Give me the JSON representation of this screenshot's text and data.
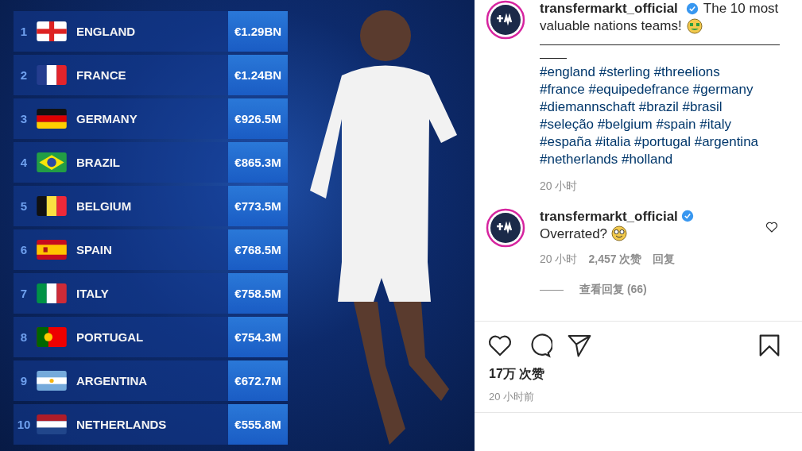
{
  "post_image": {
    "rows": [
      {
        "rank": "1",
        "country": "ENGLAND",
        "value": "€1.29BN"
      },
      {
        "rank": "2",
        "country": "FRANCE",
        "value": "€1.24BN"
      },
      {
        "rank": "3",
        "country": "GERMANY",
        "value": "€926.5M"
      },
      {
        "rank": "4",
        "country": "BRAZIL",
        "value": "€865.3M"
      },
      {
        "rank": "5",
        "country": "BELGIUM",
        "value": "€773.5M"
      },
      {
        "rank": "6",
        "country": "SPAIN",
        "value": "€768.5M"
      },
      {
        "rank": "7",
        "country": "ITALY",
        "value": "€758.5M"
      },
      {
        "rank": "8",
        "country": "PORTUGAL",
        "value": "€754.3M"
      },
      {
        "rank": "9",
        "country": "ARGENTINA",
        "value": "€672.7M"
      },
      {
        "rank": "10",
        "country": "NETHERLANDS",
        "value": "€555.8M"
      }
    ]
  },
  "caption": {
    "username": "transfermarkt_official",
    "verified": true,
    "text_lines": [
      "The 10 most",
      "valuable nations teams!"
    ],
    "hashtag_lines": [
      "#england #sterling #threelions",
      "#france #equipedefrance #germany",
      "#diemannschaft #brazil #brasil",
      "#seleção #belgium #spain #italy",
      "#españa #italia #portugal #argentina",
      "#netherlands #holland"
    ],
    "time": "20 小时"
  },
  "comment": {
    "username": "transfermarkt_official",
    "verified": true,
    "text": "Overrated?",
    "time": "20 小时",
    "likes": "2,457 次赞",
    "reply": "回复",
    "view_replies": "查看回复 (66)"
  },
  "actions": {
    "likes": "17万 次赞",
    "time": "20 小时前"
  }
}
